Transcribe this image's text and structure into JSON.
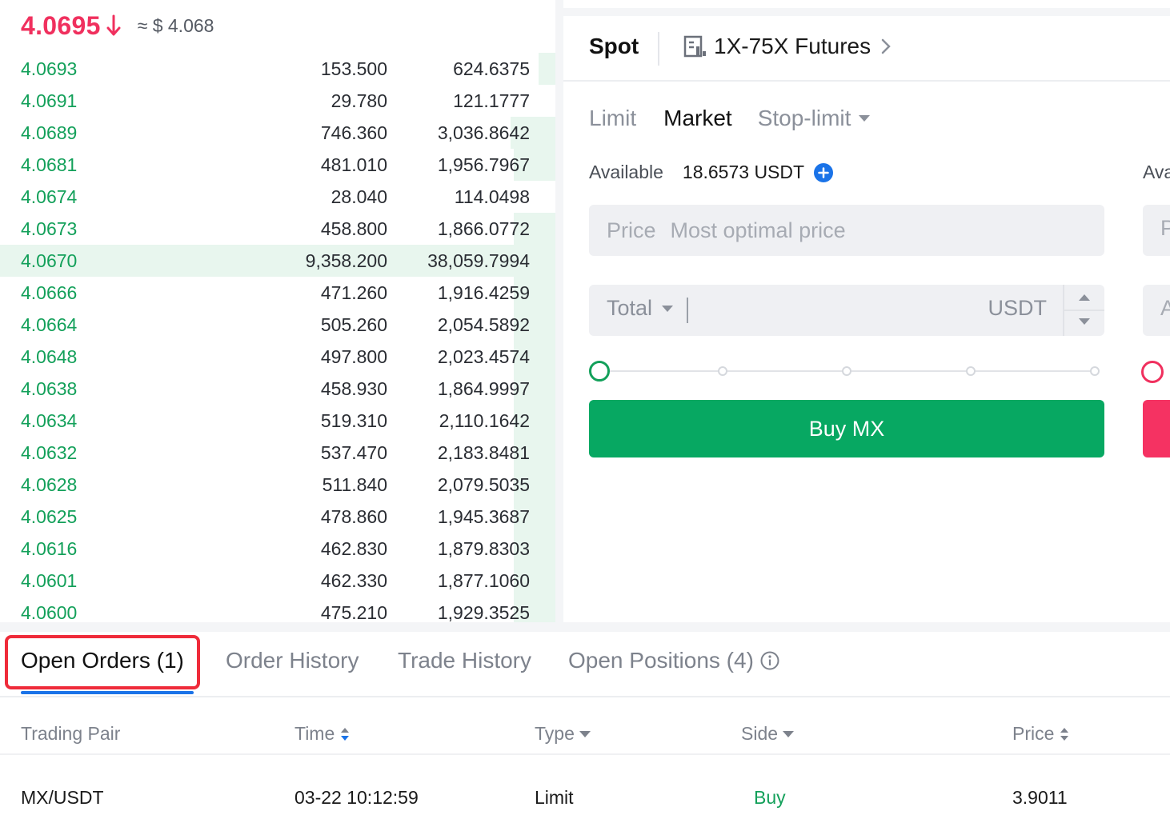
{
  "order_book": {
    "last_price": "4.0695",
    "last_price_direction": "down-arrow-icon",
    "approx_usd": "≈ $ 4.068",
    "rows": [
      {
        "price": "4.0693",
        "amount": "153.500",
        "total": "624.6375",
        "depth": 0.02
      },
      {
        "price": "4.0691",
        "amount": "29.780",
        "total": "121.1777",
        "depth": 0.0
      },
      {
        "price": "4.0689",
        "amount": "746.360",
        "total": "3,036.8642",
        "depth": 0.08
      },
      {
        "price": "4.0681",
        "amount": "481.010",
        "total": "1,956.7967",
        "depth": 0.05
      },
      {
        "price": "4.0674",
        "amount": "28.040",
        "total": "114.0498",
        "depth": 0.0
      },
      {
        "price": "4.0673",
        "amount": "458.800",
        "total": "1,866.0772",
        "depth": 0.05
      },
      {
        "price": "4.0670",
        "amount": "9,358.200",
        "total": "38,059.7994",
        "depth": 1.0,
        "highlight": true
      },
      {
        "price": "4.0666",
        "amount": "471.260",
        "total": "1,916.4259",
        "depth": 0.05
      },
      {
        "price": "4.0664",
        "amount": "505.260",
        "total": "2,054.5892",
        "depth": 0.05
      },
      {
        "price": "4.0648",
        "amount": "497.800",
        "total": "2,023.4574",
        "depth": 0.05
      },
      {
        "price": "4.0638",
        "amount": "458.930",
        "total": "1,864.9997",
        "depth": 0.05
      },
      {
        "price": "4.0634",
        "amount": "519.310",
        "total": "2,110.1642",
        "depth": 0.05
      },
      {
        "price": "4.0632",
        "amount": "537.470",
        "total": "2,183.8481",
        "depth": 0.05
      },
      {
        "price": "4.0628",
        "amount": "511.840",
        "total": "2,079.5035",
        "depth": 0.05
      },
      {
        "price": "4.0625",
        "amount": "478.860",
        "total": "1,945.3687",
        "depth": 0.05
      },
      {
        "price": "4.0616",
        "amount": "462.830",
        "total": "1,879.8303",
        "depth": 0.05
      },
      {
        "price": "4.0601",
        "amount": "462.330",
        "total": "1,877.1060",
        "depth": 0.05
      },
      {
        "price": "4.0600",
        "amount": "475.210",
        "total": "1,929.3525",
        "depth": 0.05
      }
    ]
  },
  "trade_panel": {
    "tab_spot": "Spot",
    "tab_futures": "1X-75X Futures",
    "order_types": {
      "limit": "Limit",
      "market": "Market",
      "stop_limit": "Stop-limit"
    },
    "available_label": "Available",
    "available_value": "18.6573 USDT",
    "available_label_2": "Ava",
    "price_label": "Price",
    "price_placeholder": "Most optimal price",
    "price_label_2": "P",
    "total_label": "Total",
    "total_unit": "USDT",
    "total_label_2": "A",
    "slider_percent": 0,
    "buy_button": "Buy MX"
  },
  "colors": {
    "buy_green": "#07a862",
    "sell_red": "#f53262",
    "price_down": "#f0305e",
    "tab_accent": "#1a73e8",
    "highlight_box": "#ef2b3a"
  },
  "bottom_panel": {
    "tabs": {
      "open_orders": "Open Orders (1)",
      "order_history": "Order History",
      "trade_history": "Trade History",
      "open_positions": "Open Positions (4)"
    },
    "columns": {
      "trading_pair": "Trading Pair",
      "time": "Time",
      "type": "Type",
      "side": "Side",
      "price": "Price"
    },
    "orders": [
      {
        "trading_pair": "MX/USDT",
        "time": "03-22 10:12:59",
        "type": "Limit",
        "side": "Buy",
        "price": "3.9011"
      }
    ]
  }
}
